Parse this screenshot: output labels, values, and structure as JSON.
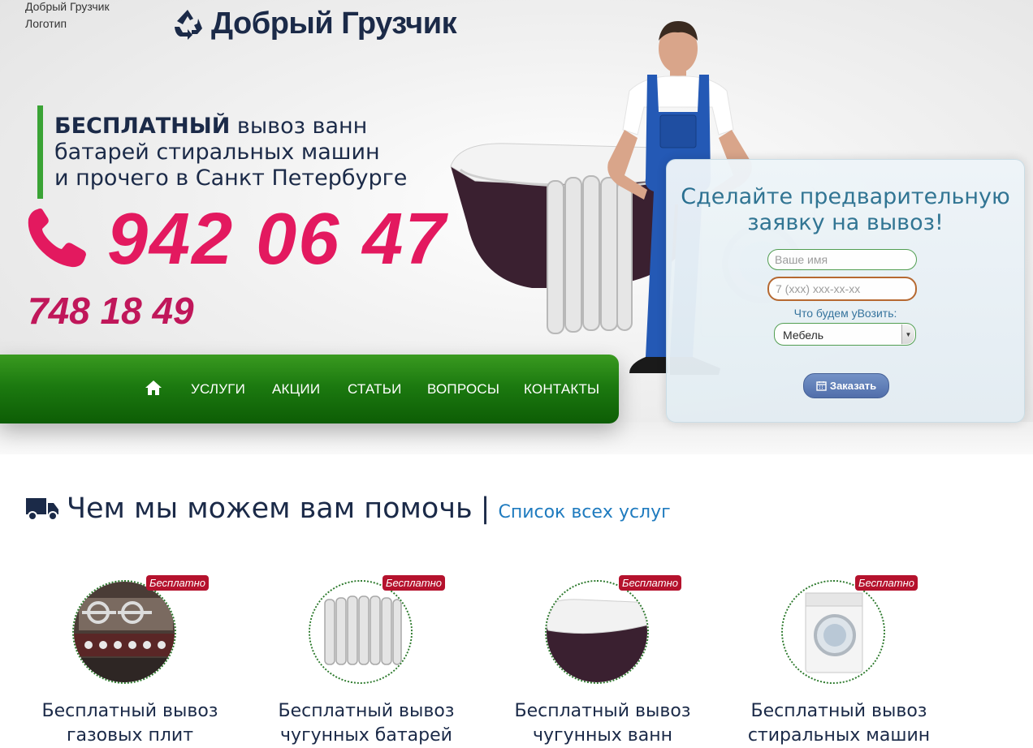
{
  "header": {
    "logo_alt_line1": "Добрый Грузчик",
    "logo_alt_line2": "Логотип",
    "brand_name": "Добрый Грузчик"
  },
  "hero": {
    "tagline_bold": "БЕСПЛАТНЫЙ",
    "tagline_line1_rest": " вывоз ванн",
    "tagline_line2": "батарей стиральных машин",
    "tagline_line3": "и прочего в Санкт Петербурге",
    "phone_main": "942 06 47",
    "phone_second": "748 18 49",
    "accent_color": "#e3195f"
  },
  "nav": {
    "home_icon": "home-icon",
    "items": [
      {
        "label": "УСЛУГИ"
      },
      {
        "label": "АКЦИИ"
      },
      {
        "label": "СТАТЬИ"
      },
      {
        "label": "ВОПРОСЫ"
      },
      {
        "label": "КОНТАКТЫ"
      }
    ],
    "color": "#1c7a10"
  },
  "order_form": {
    "title_line1": "Сделайте предварительную",
    "title_line2": "заявку на вывоз!",
    "name_placeholder": "Ваше имя",
    "phone_placeholder": "7 (xxx) xxx-xx-xx",
    "select_label": "Что будем уВозить:",
    "select_value": "Мебель",
    "submit_label": "Заказать",
    "submit_icon": "calendar-icon"
  },
  "services": {
    "title": "Чем мы можем вам помочь",
    "separator": "|",
    "all_link": "Список всех услуг",
    "icon": "truck-icon",
    "badge": "Бесплатно",
    "items": [
      {
        "line1": "Бесплатный вывоз",
        "line2": "газовых плит"
      },
      {
        "line1": "Бесплатный вывоз",
        "line2": "чугунных батарей"
      },
      {
        "line1": "Бесплатный вывоз",
        "line2": "чугунных ванн"
      },
      {
        "line1": "Бесплатный вывоз",
        "line2": "стиральных машин"
      }
    ]
  }
}
